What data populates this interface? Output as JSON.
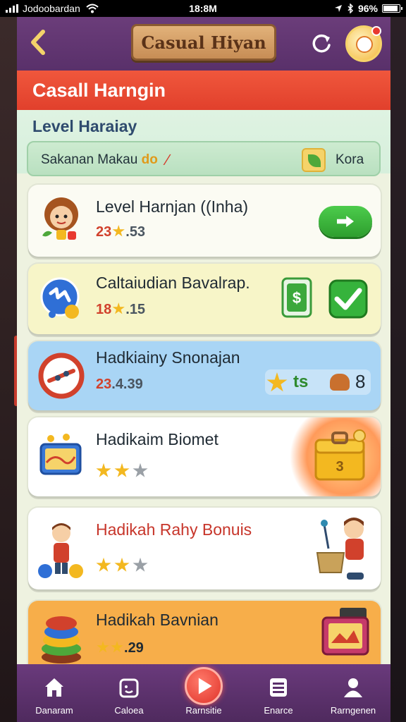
{
  "status_bar": {
    "carrier": "Jodoobardan",
    "time": "18:8M",
    "battery": "96%"
  },
  "header": {
    "title": "Casual Hiyan"
  },
  "banner": {
    "title": "Casall Harngin"
  },
  "section": {
    "title": "Level Haraiay",
    "sub_label": "Sakanan Makau",
    "sub_accent": "do",
    "sub_right": "Kora"
  },
  "cards": [
    {
      "name": "Level Harnjan ((Inha)",
      "score_red": "23",
      "score_rest": "53",
      "bg": "#fbfbf3"
    },
    {
      "name": "Caltaiudian Bavalrap.",
      "score_red": "18",
      "score_rest": "15",
      "bg": "#f7f5c8"
    },
    {
      "name": "Hadkiainy Snonajan",
      "score_red": "23",
      "score_rest": "4.39",
      "badge_left": "ts",
      "badge_right": "8",
      "bg": "#a9d5f5"
    },
    {
      "name": "Hadikaim Biomet",
      "stars": 2,
      "bg": "#ffffff"
    },
    {
      "name": "Hadikah Rahy Bonuis",
      "stars": 2,
      "bg": "#ffffff"
    },
    {
      "name": "Hadikah Bavnian",
      "score_rest": "29",
      "bg": "#f7ae4a"
    }
  ],
  "nav": {
    "items": [
      {
        "label": "Danaram"
      },
      {
        "label": "Caloea"
      },
      {
        "label": "Rarnsitie"
      },
      {
        "label": "Enarce"
      },
      {
        "label": "Rarngenen"
      }
    ]
  }
}
